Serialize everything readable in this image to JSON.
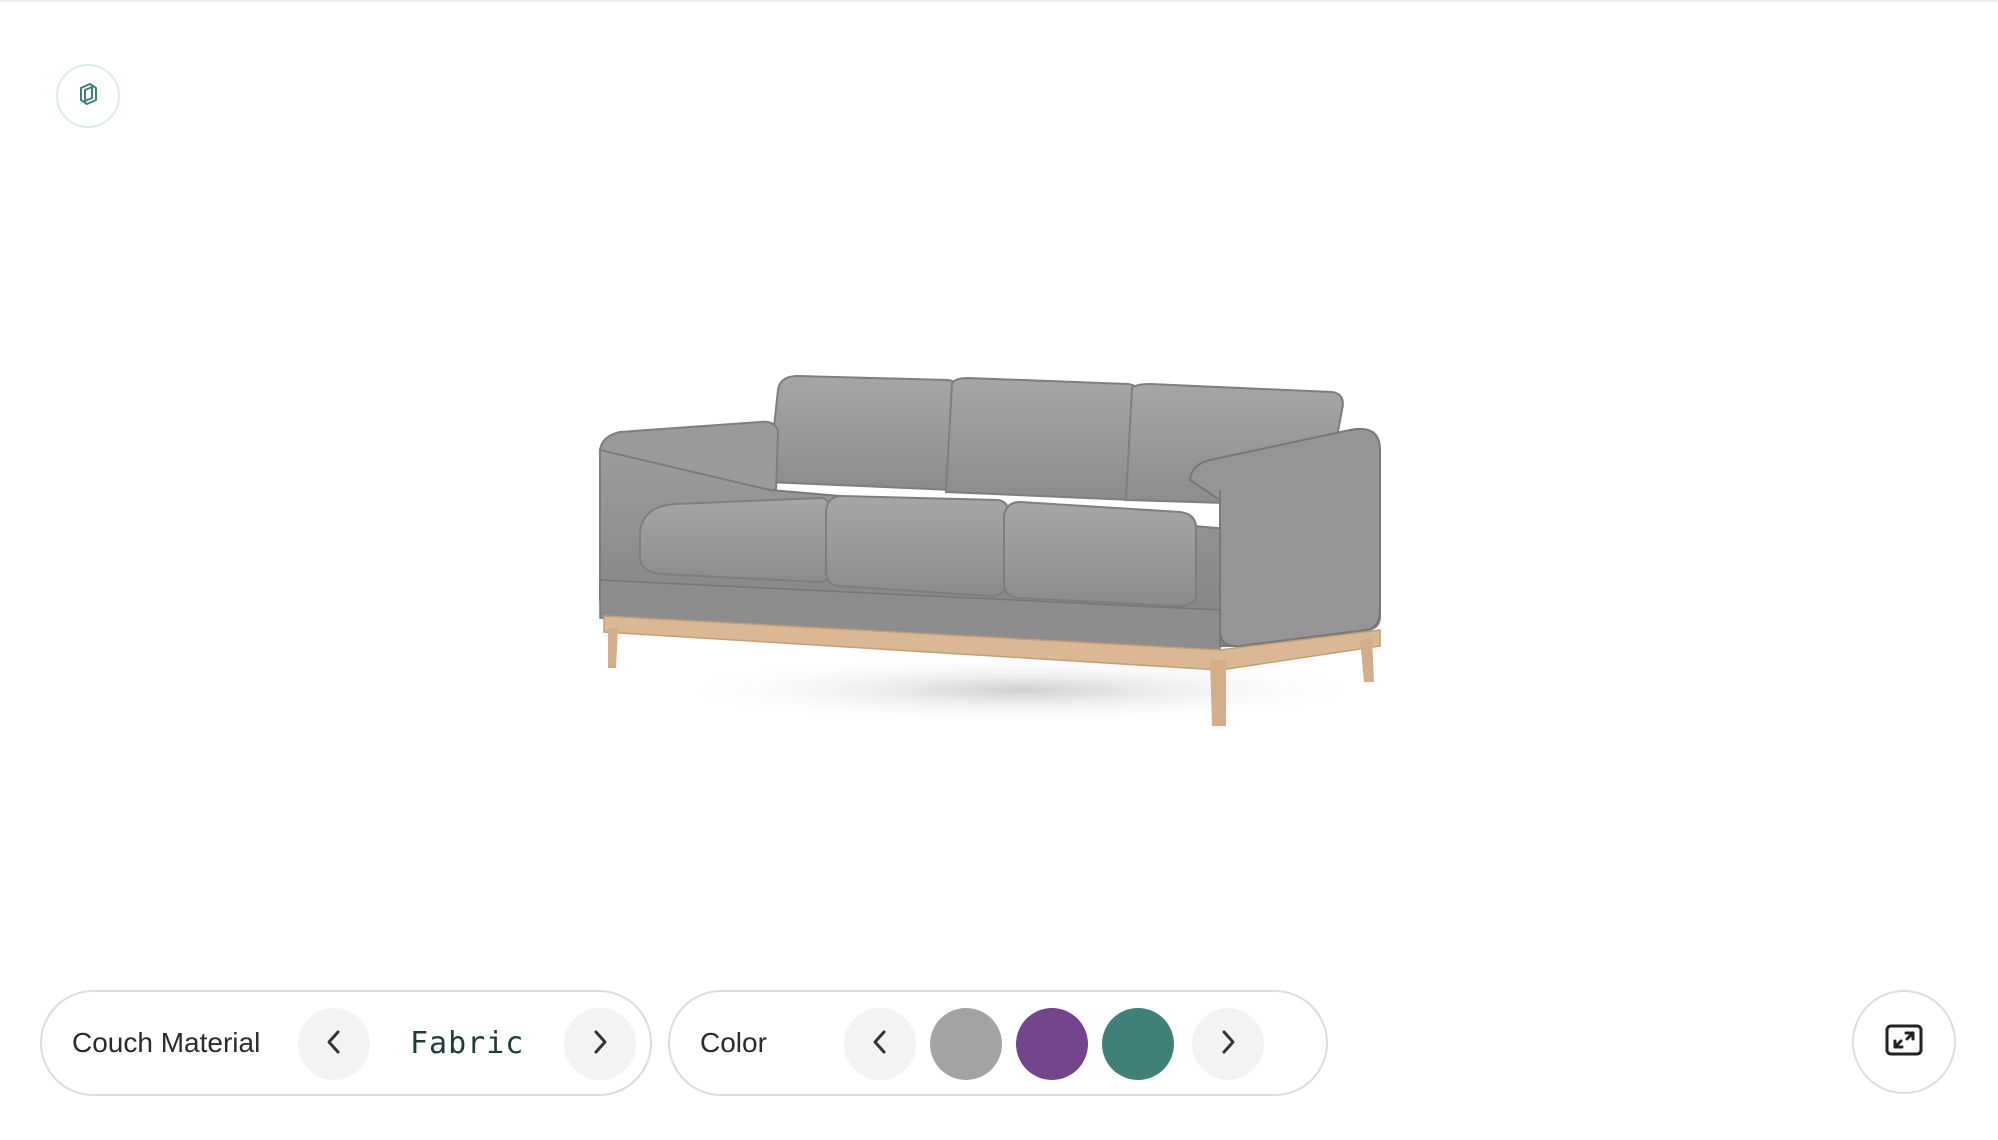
{
  "material": {
    "label": "Couch Material",
    "value": "Fabric"
  },
  "color": {
    "label": "Color",
    "swatches": [
      "#a3a3a3",
      "#74448c",
      "#3f8078"
    ]
  },
  "icons": {
    "logo": "cube-logo-icon",
    "prev": "chevron-left-icon",
    "next": "chevron-right-icon",
    "expand": "expand-icon"
  },
  "colors": {
    "accent": "#3f8078",
    "fabric": "#8f8f8f",
    "wood": "#d8b38e"
  }
}
